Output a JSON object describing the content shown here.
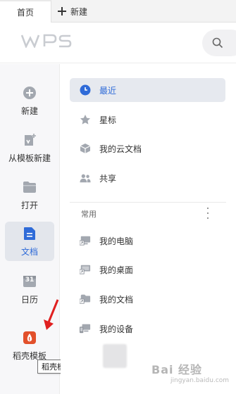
{
  "tabs": {
    "home": "首页",
    "new": "新建"
  },
  "header": {
    "logo_text": "WPS"
  },
  "rail": {
    "items": [
      {
        "label": "新建",
        "icon": "plus-circle-icon",
        "active": false
      },
      {
        "label": "从模板新建",
        "icon": "template-icon",
        "active": false
      },
      {
        "label": "打开",
        "icon": "folder-icon",
        "active": false
      },
      {
        "label": "文档",
        "icon": "document-icon",
        "active": true
      },
      {
        "label": "日历",
        "icon": "calendar-icon",
        "active": false
      },
      {
        "label": "稻壳模板",
        "icon": "docer-icon",
        "active": false
      }
    ],
    "calendar_day": "31"
  },
  "tooltip": "稻壳模板",
  "main": {
    "nav": [
      {
        "label": "最近",
        "icon": "clock-icon",
        "active": true
      },
      {
        "label": "星标",
        "icon": "star-icon",
        "active": false
      },
      {
        "label": "我的云文档",
        "icon": "cloud-cube-icon",
        "active": false
      },
      {
        "label": "共享",
        "icon": "people-icon",
        "active": false
      }
    ],
    "section_title": "常用",
    "common": [
      {
        "label": "我的电脑",
        "icon": "computer-shortcut-icon"
      },
      {
        "label": "我的桌面",
        "icon": "desktop-shortcut-icon"
      },
      {
        "label": "我的文档",
        "icon": "folder-shortcut-icon"
      },
      {
        "label": "我的设备",
        "icon": "devices-icon"
      }
    ]
  },
  "watermark": {
    "text": "Bai 经验",
    "sub": "jingyan.baidu.com"
  },
  "colors": {
    "accent": "#2f6bd8",
    "icon_gray": "#9aa0a8",
    "docer_red": "#e2502b"
  }
}
